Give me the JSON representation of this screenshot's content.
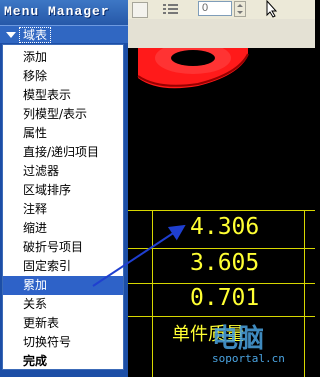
{
  "app": {
    "title": "Menu Manager"
  },
  "toolbar": {
    "spin_value": "0"
  },
  "menu": {
    "section_label": "域表",
    "items": [
      {
        "label": "添加"
      },
      {
        "label": "移除"
      },
      {
        "label": "模型表示"
      },
      {
        "label": "列模型/表示"
      },
      {
        "label": "属性"
      },
      {
        "label": "直接/递归项目"
      },
      {
        "label": "过滤器"
      },
      {
        "label": "区域排序"
      },
      {
        "label": "注释"
      },
      {
        "label": "缩进"
      },
      {
        "label": "破折号项目"
      },
      {
        "label": "固定索引"
      },
      {
        "label": "累加"
      },
      {
        "label": "关系"
      },
      {
        "label": "更新表"
      },
      {
        "label": "切换符号"
      },
      {
        "label": "完成"
      }
    ]
  },
  "drawing": {
    "values": [
      "4.306",
      "3.605",
      "0.701"
    ],
    "footer_label": "单件质量"
  },
  "watermark": {
    "main": "电脑",
    "domain": "soportal.cn"
  },
  "colors": {
    "menu_blue": "#2e62c8",
    "table_yellow": "#ffff33",
    "red_part": "#ff1a1a"
  }
}
